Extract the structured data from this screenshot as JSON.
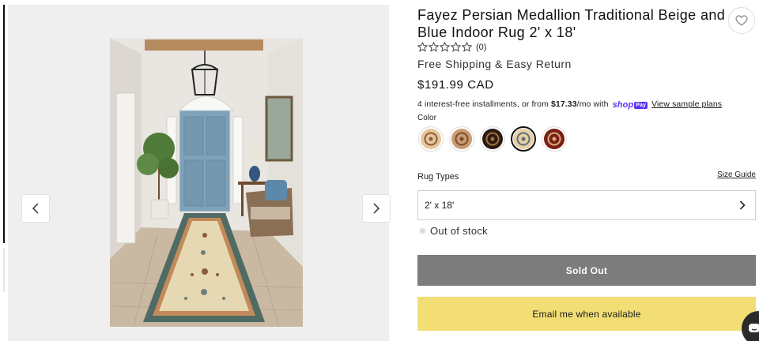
{
  "product": {
    "title": "Fayez Persian Medallion Traditional Beige and Blue Indoor Rug 2' x 18'",
    "rating_count": "(0)",
    "shipping": "Free Shipping & Easy Return",
    "price": "$191.99 CAD"
  },
  "installments": {
    "prefix": "4 interest-free installments, or from ",
    "amount": "$17.33",
    "suffix": "/mo with ",
    "shop_word": "shop",
    "pay_word": "Pay",
    "link": "View sample plans"
  },
  "color": {
    "label": "Color",
    "swatches": [
      {
        "name": "beige",
        "color": "#e6c79c",
        "accent": "#8a5a3a"
      },
      {
        "name": "tan",
        "color": "#c99c72",
        "accent": "#7a4a2c"
      },
      {
        "name": "black",
        "color": "#2a1a14",
        "accent": "#a8743c"
      },
      {
        "name": "beige-blue",
        "color": "#e9cfa6",
        "accent": "#5b6f7a"
      },
      {
        "name": "red",
        "color": "#7a1e18",
        "accent": "#d6b27a"
      }
    ],
    "selected_index": 3
  },
  "rug_types": {
    "label": "Rug Types",
    "size_guide": "Size Guide",
    "selected": "2' x 18'"
  },
  "stock": {
    "status": "Out of stock"
  },
  "buttons": {
    "sold_out": "Sold Out",
    "email": "Email me when available"
  },
  "icons": {
    "prev": "chevron-left-icon",
    "next": "chevron-right-icon",
    "wishlist": "heart-icon",
    "star": "star-outline-icon",
    "chat": "chat-icon"
  },
  "colors": {
    "accent_yellow": "#f2de75",
    "sold_out_gray": "#7c7c7c",
    "shop_purple": "#5a31f4"
  }
}
